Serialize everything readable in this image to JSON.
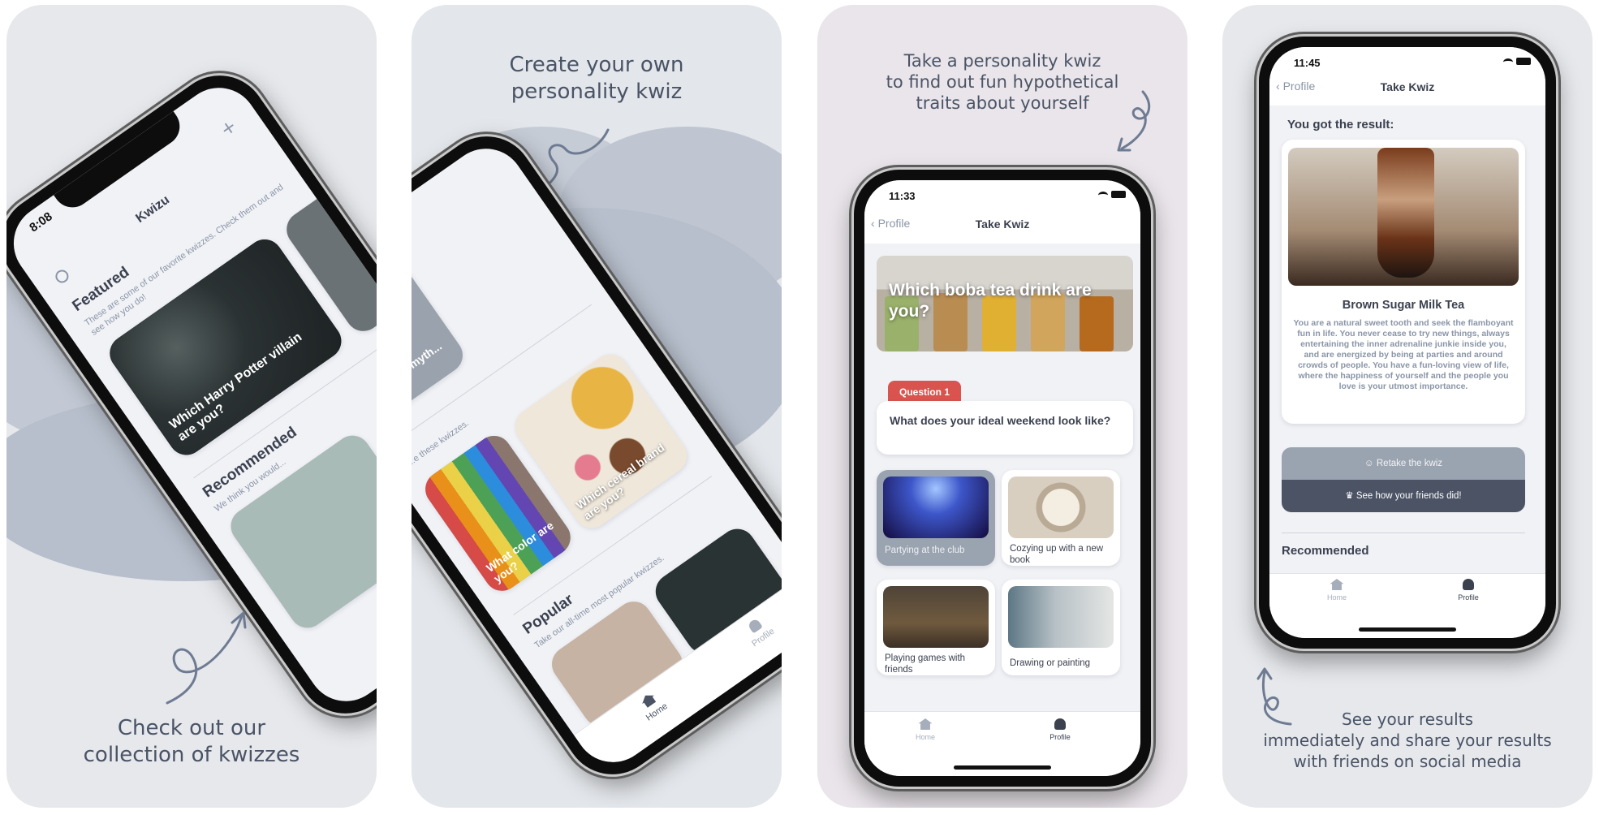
{
  "panels": [
    {
      "caption": [
        "Check out our",
        "collection of kwizzes"
      ],
      "screen": {
        "time": "8:08",
        "title": "Kwizu",
        "featured_heading": "Featured",
        "featured_desc": "These are some of our favorite kwizzes. Check them out and see how you do!",
        "featured_card": "Which Harry Potter villain are you?",
        "recommended_heading": "Recommended",
        "recommended_desc": "We think you would..."
      }
    },
    {
      "caption": [
        "Create your own",
        "personality kwiz"
      ],
      "screen": {
        "card_myth": "Which myth... you?",
        "desc_like": "...e these kwizzes.",
        "card_cereal": "Which cereal brand are you?",
        "card_color": "What color are you?",
        "popular_heading": "Popular",
        "popular_desc": "Take our all-time most popular kwizzes.",
        "tab_home": "Home",
        "tab_profile": "Profile"
      }
    },
    {
      "caption": [
        "Take a personality kwiz",
        "to find out fun hypothetical",
        "traits about yourself"
      ],
      "screen": {
        "time": "11:33",
        "back": "Profile",
        "title": "Take Kwiz",
        "kwiz_title": "Which boba tea drink are you?",
        "question_badge": "Question 1",
        "question": "What does your ideal weekend look like?",
        "options": [
          {
            "label": "Partying at the club",
            "selected": true
          },
          {
            "label": "Cozying up with a new book",
            "selected": false
          },
          {
            "label": "Playing games with friends",
            "selected": false
          },
          {
            "label": "Drawing or painting",
            "selected": false
          }
        ],
        "tab_home": "Home",
        "tab_profile": "Profile"
      }
    },
    {
      "caption": [
        "See your results",
        "immediately and share your results",
        "with friends on social media"
      ],
      "screen": {
        "time": "11:45",
        "back": "Profile",
        "title": "Take Kwiz",
        "result_heading": "You got the result:",
        "result_name": "Brown Sugar Milk Tea",
        "result_desc": "You are a natural sweet tooth and seek the flamboyant fun in life. You never cease to try new things, always entertaining the inner adrenaline junkie inside you, and are energized by being at parties and around crowds of people. You have a fun-loving view of life, where the happiness of yourself and the people you love is your utmost importance.",
        "retake_button": "Retake the kwiz",
        "friends_button": "See how your friends did!",
        "recommended_heading": "Recommended",
        "tab_home": "Home",
        "tab_profile": "Profile"
      }
    }
  ],
  "colors": {
    "accent_red": "#d9534f",
    "slate": "#4b5365",
    "cloud": "#b9c1ce"
  },
  "icons": [
    "search-icon",
    "plus-icon",
    "home-icon",
    "profile-icon",
    "chevron-left-icon",
    "smile-icon",
    "trophy-icon",
    "wifi-icon",
    "battery-icon",
    "signal-icon"
  ]
}
